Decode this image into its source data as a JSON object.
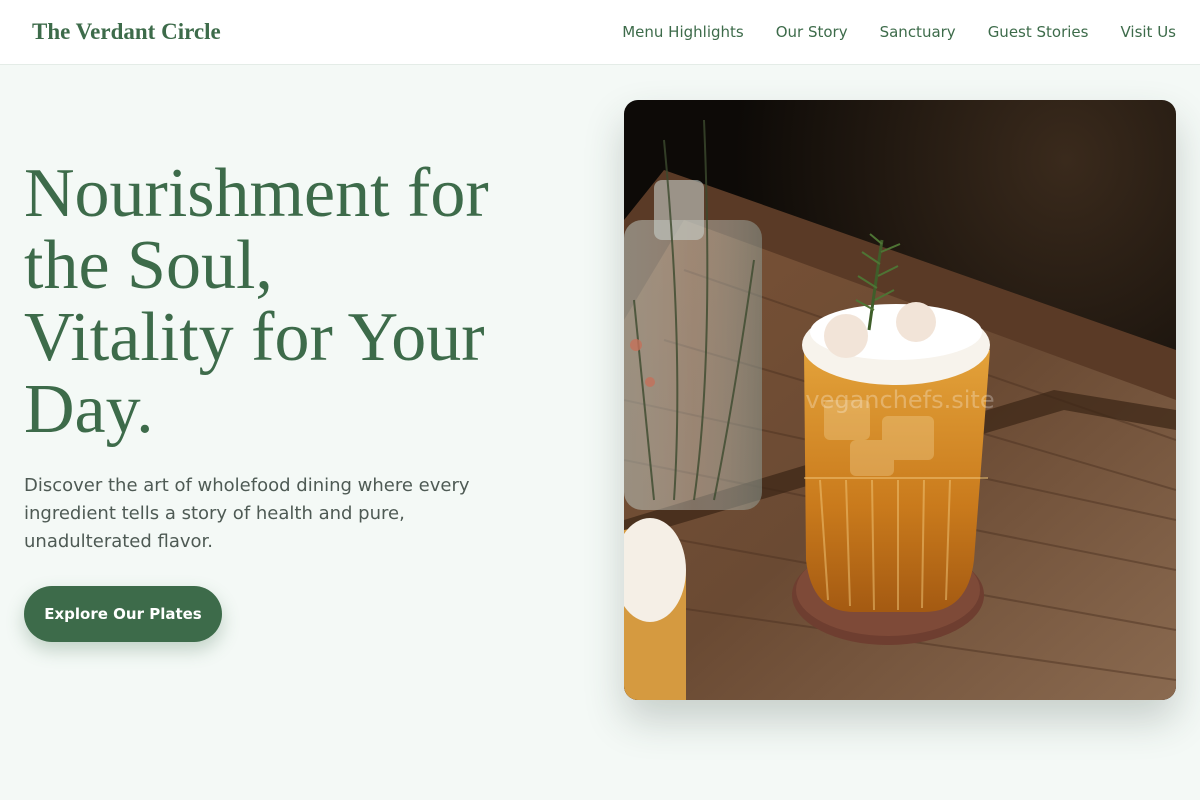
{
  "brand": {
    "name": "The Verdant Circle"
  },
  "nav": {
    "links": [
      "Menu Highlights",
      "Our Story",
      "Sanctuary",
      "Guest Stories",
      "Visit Us"
    ]
  },
  "hero": {
    "title_lines": [
      "Nourishment for",
      "the Soul,",
      "Vitality for Your",
      "Day."
    ],
    "description": "Discover the art of wholefood dining where every ingredient tells a story of health and pure, unadulterated flavor.",
    "cta_label": "Explore Our Plates"
  },
  "image": {
    "subject": "amber cocktail with foam and rosemary sprig on wooden table",
    "watermark": "veganchefs.site"
  },
  "colors": {
    "accent": "#3d6b4a",
    "page_background": "#f4f9f6",
    "body_text": "#4e5a54"
  }
}
